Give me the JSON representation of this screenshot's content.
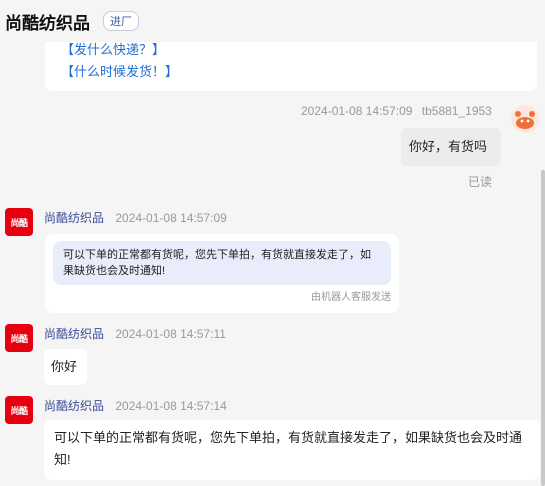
{
  "header": {
    "shop_name": "尚酷纺织品",
    "enter_label": "进厂"
  },
  "faq": {
    "item_cut": "【发什么快递？】",
    "item_full": "【什么时候发货！】"
  },
  "messages": [
    {
      "time": "2024-01-08 14:57:09",
      "sender": "tb5881_1953",
      "text": "你好，有货吗",
      "status": "已读"
    },
    {
      "time": "2024-01-08 14:57:09",
      "sender": "尚酷纺织品",
      "avatar_text": "尚酷",
      "text": "可以下单的正常都有货呢，您先下单拍，有货就直接发走了，如果缺货也会及时通知!",
      "tag": "由机器人客服发送"
    },
    {
      "time": "2024-01-08 14:57:11",
      "sender": "尚酷纺织品",
      "avatar_text": "尚酷",
      "text": "你好"
    },
    {
      "time": "2024-01-08 14:57:14",
      "sender": "尚酷纺织品",
      "avatar_text": "尚酷",
      "text": "可以下单的正常都有货呢，您先下单拍，有货就直接发走了，如果缺货也会及时通知!"
    }
  ],
  "colors": {
    "brand_red": "#e4000f",
    "link_blue": "#1f6fd1",
    "robot_bg": "#e8ecfb"
  }
}
